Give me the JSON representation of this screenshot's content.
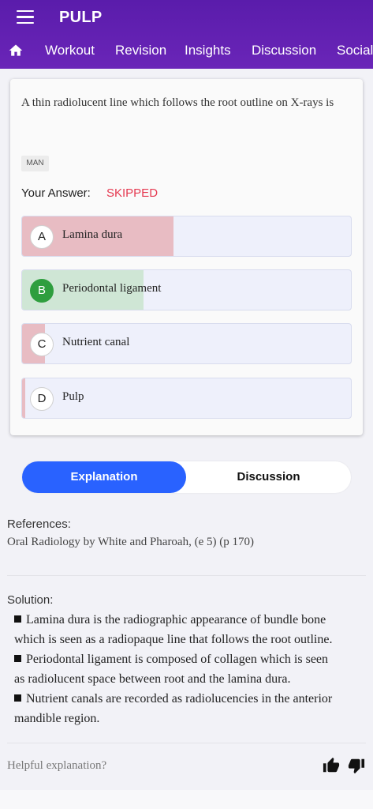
{
  "appbar": {
    "title": "PULP",
    "menu_icon": "hamburger-menu-icon",
    "home_icon": "home-icon",
    "tabs": [
      {
        "label": "Workout"
      },
      {
        "label": "Revision"
      },
      {
        "label": "Insights"
      },
      {
        "label": "Discussion"
      },
      {
        "label": "Social"
      }
    ]
  },
  "question": {
    "text": "A thin radiolucent line which follows the root outline on X-rays is",
    "tag": "MAN",
    "your_answer_label": "Your Answer:",
    "your_answer_value": "SKIPPED",
    "options": [
      {
        "letter": "A",
        "text": "Lamina dura",
        "response_fraction": 0.46,
        "correct": false
      },
      {
        "letter": "B",
        "text": "Periodontal ligament",
        "response_fraction": 0.37,
        "correct": true
      },
      {
        "letter": "C",
        "text": "Nutrient canal",
        "response_fraction": 0.07,
        "correct": false
      },
      {
        "letter": "D",
        "text": "Pulp",
        "response_fraction": 0.01,
        "correct": false
      }
    ]
  },
  "colors": {
    "accent": "#2962ff",
    "header": "#5a1cab",
    "wrong_fill": "#e8bcc3",
    "correct_fill": "#cfe6d5",
    "skipped": "#e53950"
  },
  "toggle": {
    "explanation_label": "Explanation",
    "discussion_label": "Discussion",
    "active": "Explanation"
  },
  "explanation": {
    "references_label": "References:",
    "reference_text": "Oral Radiology by White and Pharoah, (e 5) (p 170)",
    "solution_label": "Solution:",
    "solution_lines": [
      "Lamina dura is the radiographic appearance of bundle bone",
      "which is seen as a radiopaque line that follows the root outline.",
      "Periodontal ligament is composed of collagen which is seen",
      "as radiolucent space between root and the lamina dura.",
      "Nutrient canals are recorded as radiolucencies in the anterior",
      "mandible region."
    ],
    "helpful_label": "Helpful explanation?",
    "thumbs_up_icon": "thumbs-up-icon",
    "thumbs_down_icon": "thumbs-down-icon"
  }
}
